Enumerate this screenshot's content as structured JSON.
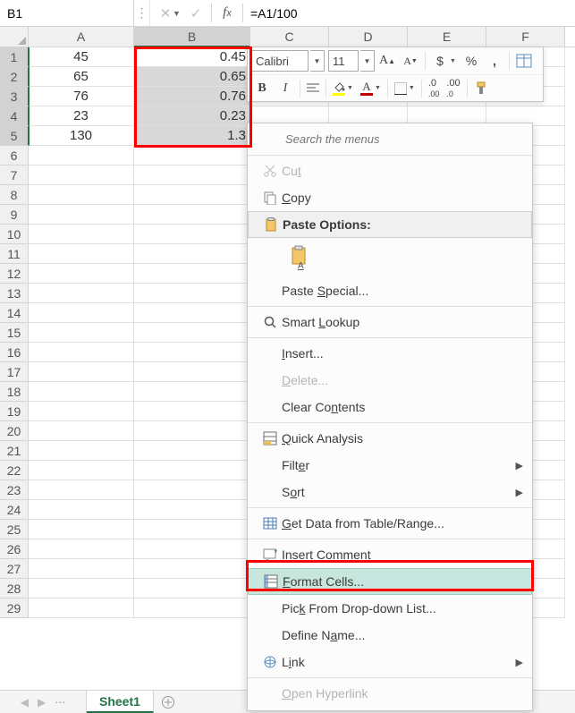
{
  "name_box": {
    "value": "B1"
  },
  "formula_bar": {
    "value": "=A1/100"
  },
  "columns": {
    "A": "A",
    "B": "B",
    "C": "C",
    "D": "D",
    "E": "E",
    "F": "F"
  },
  "col_widths": {
    "A": 118,
    "B": 130,
    "C": 88,
    "D": 88,
    "E": 88,
    "F": 88
  },
  "rows": {
    "1": {
      "A": "45",
      "B": "0.45"
    },
    "2": {
      "A": "65",
      "B": "0.65"
    },
    "3": {
      "A": "76",
      "B": "0.76"
    },
    "4": {
      "A": "23",
      "B": "0.23"
    },
    "5": {
      "A": "130",
      "B": "1.3"
    }
  },
  "mini_toolbar": {
    "font_name": "Calibri",
    "font_size": "11",
    "bold": "B",
    "italic": "I",
    "percent": "%"
  },
  "context_menu": {
    "search_placeholder": "Search the menus",
    "cut": "Cut",
    "copy": "Copy",
    "paste_options": "Paste Options:",
    "paste_special": "Paste Special...",
    "smart_lookup": "Smart Lookup",
    "insert": "Insert...",
    "delete": "Delete...",
    "clear_contents": "Clear Contents",
    "quick_analysis": "Quick Analysis",
    "filter": "Filter",
    "sort": "Sort",
    "get_data": "Get Data from Table/Range...",
    "insert_comment": "Insert Comment",
    "format_cells": "Format Cells...",
    "pick_list": "Pick From Drop-down List...",
    "define_name": "Define Name...",
    "link": "Link",
    "open_hyperlink": "Open Hyperlink"
  },
  "sheet_tabs": {
    "active": "Sheet1"
  },
  "colors": {
    "excel_green": "#217346",
    "red": "#ff0000",
    "font_red": "#c00000"
  }
}
